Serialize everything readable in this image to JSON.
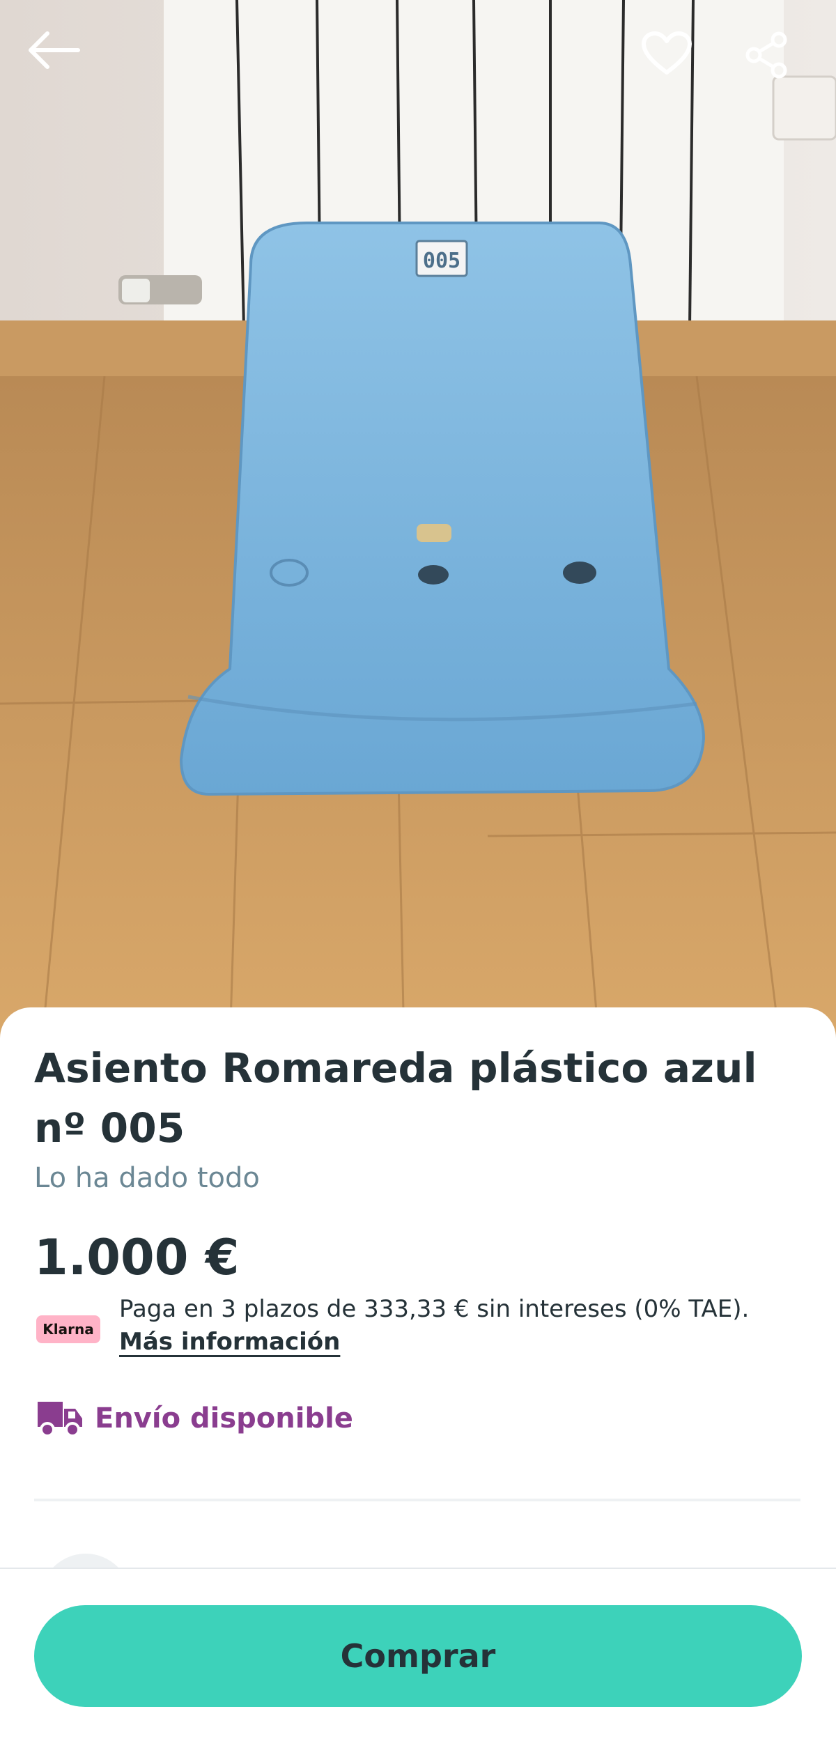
{
  "listing": {
    "title": "Asiento Romareda plástico azul nº 005",
    "condition": "Lo ha dado todo",
    "price": "1.000 €",
    "seat_number_tag": "005"
  },
  "klarna": {
    "badge": "Klarna",
    "installments_text": "Paga en 3 plazos de 333,33 € sin intereses (0% TAE).",
    "more_info_label": "Más información"
  },
  "shipping": {
    "label": "Envío disponible",
    "color": "#8a3d8f"
  },
  "actions": {
    "buy_label": "Comprar",
    "buy_color": "#3dd2ba"
  },
  "icons": {
    "back": "arrow-left-icon",
    "favorite": "heart-icon",
    "share": "share-icon",
    "shipping": "truck-icon"
  }
}
